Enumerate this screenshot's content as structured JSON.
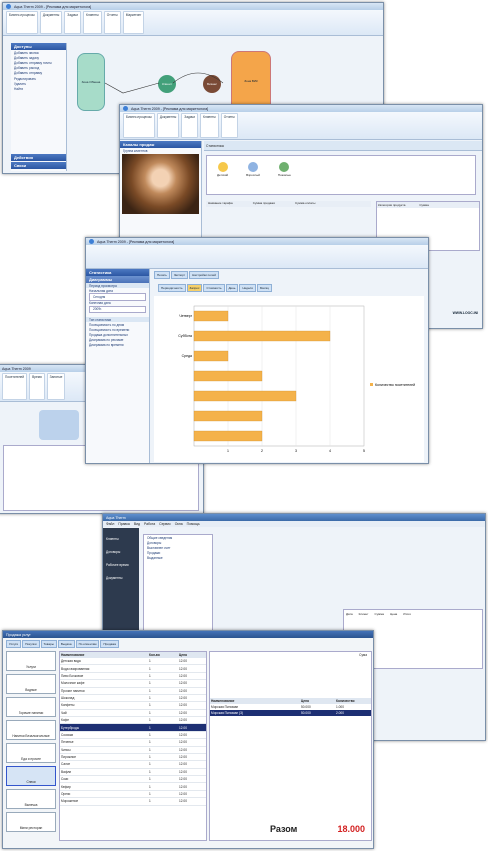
{
  "bg_text": [
    "м,",
    "ые",
    "ен",
    "и"
  ],
  "win1": {
    "title": "Aqua Therm 2009 - [Реклама для маркетолога]",
    "sidebar_title": "Доступы",
    "sidebar_items": [
      "Добавить звонок",
      "Добавить задачу",
      "Добавить отправку почты",
      "Добавить расход",
      "Добавить отправку",
      "Редактировать",
      "Удалить",
      "Найти"
    ],
    "sidebar_footer": [
      "Действия",
      "Связи"
    ],
    "ribbon": [
      "Бизнес-процессы",
      "Документы",
      "Задачи",
      "Клиенты",
      "Отчеты",
      "Маркетинг"
    ],
    "nodes": [
      "Зона Обмена",
      "Клиент",
      "Бизнес",
      "Зона ВИК"
    ]
  },
  "win2": {
    "title": "Aqua Therm 2009 - [Реклама для маркетолога]",
    "panel_title": "Каналы продаж",
    "tab": "Статистика",
    "list_header": "Группа клиентов",
    "icons": [
      "Детский",
      "Взрослый",
      "Пожилые"
    ],
    "cols": [
      "Название тарифа",
      "Сумма продажи",
      "Сумма оплаты"
    ],
    "right_cols": [
      "Категория продукта",
      "Сумма"
    ],
    "status": "WWW.LOOC.INI"
  },
  "win3": {
    "title": "Aqua Therm 2009 - [Реклама для маркетолога]",
    "sidebar_header": "Статистика",
    "sidebar_sub": "Диаграммы",
    "filter_title": "Период просмотра",
    "date_label": "Начальная дата",
    "date_value": "Сегодня",
    "period_label": "Конечная дата",
    "period_value": "2009г.",
    "stat_header": "Тип статистики",
    "stat_items": [
      "Посещаемость по дням",
      "Посещаемость по времени",
      "Продажа дополнительных",
      "Диаграмма по рекламе",
      "Диаграмма по времени"
    ],
    "toolbar": [
      "Печать",
      "Экспорт",
      "Настройки полей"
    ],
    "filters": [
      "Периодичность",
      "Запрос",
      "Стоимость",
      "День",
      "Неделя",
      "Месяц"
    ]
  },
  "chart_data": {
    "type": "bar",
    "categories": [
      "Четверг",
      "Суббота",
      "Среда",
      "",
      "",
      "",
      ""
    ],
    "values": [
      1,
      4,
      1,
      2,
      3,
      2,
      2
    ],
    "xlim": [
      0,
      5
    ],
    "xticks": [
      1,
      2,
      3,
      4,
      5
    ],
    "legend": "Количество посетителей",
    "bar_color": "#f4b24a"
  },
  "win4": {
    "title": "Aqua Therm 2009",
    "items": [
      "Посетителей",
      "Время",
      "Занятые"
    ]
  },
  "win5": {
    "title": "Aqua Therm",
    "menu": [
      "Файл",
      "Правка",
      "Вид",
      "Работа",
      "Сервис",
      "Окна",
      "Помощь"
    ],
    "side_buttons": [
      "Клиенты",
      "Договоры",
      "Рабочее время",
      "Документы"
    ],
    "tree": [
      "Общие сведения",
      "Договоры",
      "Выставлен счет",
      "Продажи",
      "Выданные"
    ],
    "headers": [
      "Дата",
      "Клиент",
      "Сумма",
      "Цена",
      "Итого"
    ]
  },
  "win6": {
    "title": "Продажа услуг",
    "tabs": [
      "Услуги",
      "Покупки",
      "Товары",
      "Выдача",
      "По клиентам",
      "Продажа"
    ],
    "left_buttons": [
      "Услуги",
      "Водные",
      "Горячие напитки",
      "Напитки Безалкогольные",
      "Еда и прочее",
      "Снеки",
      "Выпечка",
      "Мини ресторан"
    ],
    "table_headers": [
      "Наименование",
      "Кол-во",
      "Цена"
    ],
    "rows": [
      [
        "Детская вода",
        "1",
        "12.00"
      ],
      [
        "Вода газированная",
        "1",
        "12.00"
      ],
      [
        "Пиво Бочковое",
        "1",
        "12.00"
      ],
      [
        "Молочное кафе",
        "1",
        "12.00"
      ],
      [
        "Прочие напитки",
        "1",
        "12.00"
      ],
      [
        "Шоколад",
        "1",
        "12.00"
      ],
      [
        "Конфеты",
        "1",
        "12.00"
      ],
      [
        "Чай",
        "1",
        "12.00"
      ],
      [
        "Кофе",
        "1",
        "12.00"
      ],
      [
        "Бутерброды",
        "1",
        "12.00"
      ],
      [
        "Сосиски",
        "1",
        "12.00"
      ],
      [
        "Печенье",
        "1",
        "12.00"
      ],
      [
        "Чипсы",
        "1",
        "12.00"
      ],
      [
        "Пирожное",
        "1",
        "12.00"
      ],
      [
        "Салат",
        "1",
        "12.00"
      ],
      [
        "Вафли",
        "1",
        "12.00"
      ],
      [
        "Соки",
        "1",
        "12.00"
      ],
      [
        "Кефир",
        "1",
        "12.00"
      ],
      [
        "Орехи",
        "1",
        "12.00"
      ],
      [
        "Мороженое",
        "1",
        "12.00"
      ]
    ],
    "right_headers": [
      "Наименование",
      "Цена",
      "Количество"
    ],
    "right_rows": [
      [
        "Морская Пиломан",
        "50.000",
        "1.000"
      ],
      [
        "Морская Пиломан (3)",
        "50.000",
        "2.000"
      ]
    ],
    "total_label": "Разом",
    "total_value": "18.000",
    "sum_label": "Сума"
  }
}
